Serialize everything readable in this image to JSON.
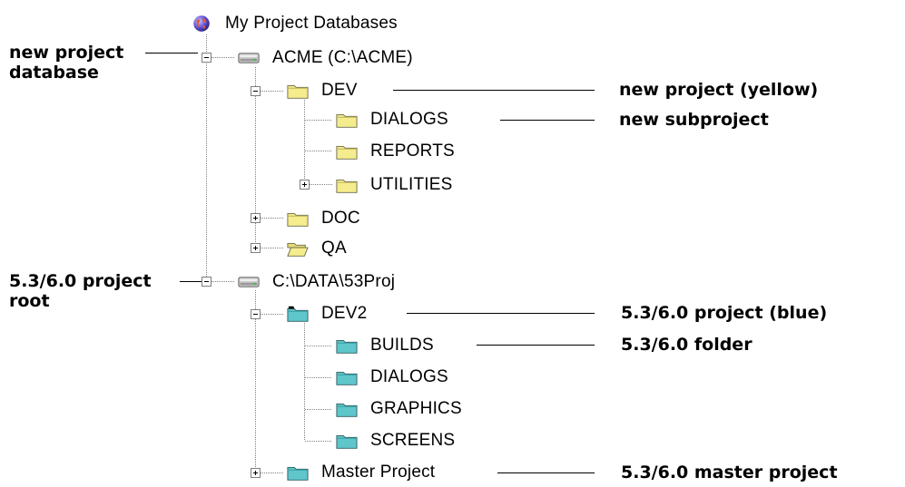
{
  "tree": {
    "root": {
      "label": "My Project Databases",
      "icon": "globe-icon"
    },
    "databases": [
      {
        "label": "ACME (C:\\ACME)",
        "icon": "drive-icon",
        "expanded": true,
        "projects": [
          {
            "label": "DEV",
            "icon": "yellow-folder-icon",
            "expanded": true,
            "children": [
              {
                "label": "DIALOGS",
                "icon": "yellow-folder-icon"
              },
              {
                "label": "REPORTS",
                "icon": "yellow-folder-icon"
              },
              {
                "label": "UTILITIES",
                "icon": "yellow-folder-icon",
                "collapsed": true
              }
            ]
          },
          {
            "label": "DOC",
            "icon": "yellow-folder-icon",
            "collapsed": true
          },
          {
            "label": "QA",
            "icon": "yellow-open-folder-icon",
            "collapsed": true
          }
        ]
      },
      {
        "label": "C:\\DATA\\53Proj",
        "icon": "drive-icon",
        "expanded": true,
        "projects": [
          {
            "label": "DEV2",
            "icon": "blue-folder-icon",
            "expanded": true,
            "children": [
              {
                "label": "BUILDS",
                "icon": "blue-folder-icon"
              },
              {
                "label": "DIALOGS",
                "icon": "blue-folder-icon"
              },
              {
                "label": "GRAPHICS",
                "icon": "blue-folder-icon"
              },
              {
                "label": "SCREENS",
                "icon": "blue-folder-icon"
              }
            ]
          },
          {
            "label": "Master Project",
            "icon": "blue-folder-icon",
            "collapsed": true
          }
        ]
      }
    ]
  },
  "callouts": {
    "new_project_database": [
      "new project",
      "database"
    ],
    "new_project_yellow": "new project (yellow)",
    "new_subproject": "new subproject",
    "project_root": [
      "5.3/6.0 project",
      "root"
    ],
    "project_blue": "5.3/6.0 project (blue)",
    "folder_53": "5.3/6.0 folder",
    "master_project": "5.3/6.0 master project"
  },
  "colors": {
    "yellow_folder": "#f5ec8e",
    "blue_folder": "#5fc6cb",
    "dotted_line": "#808080",
    "callout_line": "#000000"
  }
}
